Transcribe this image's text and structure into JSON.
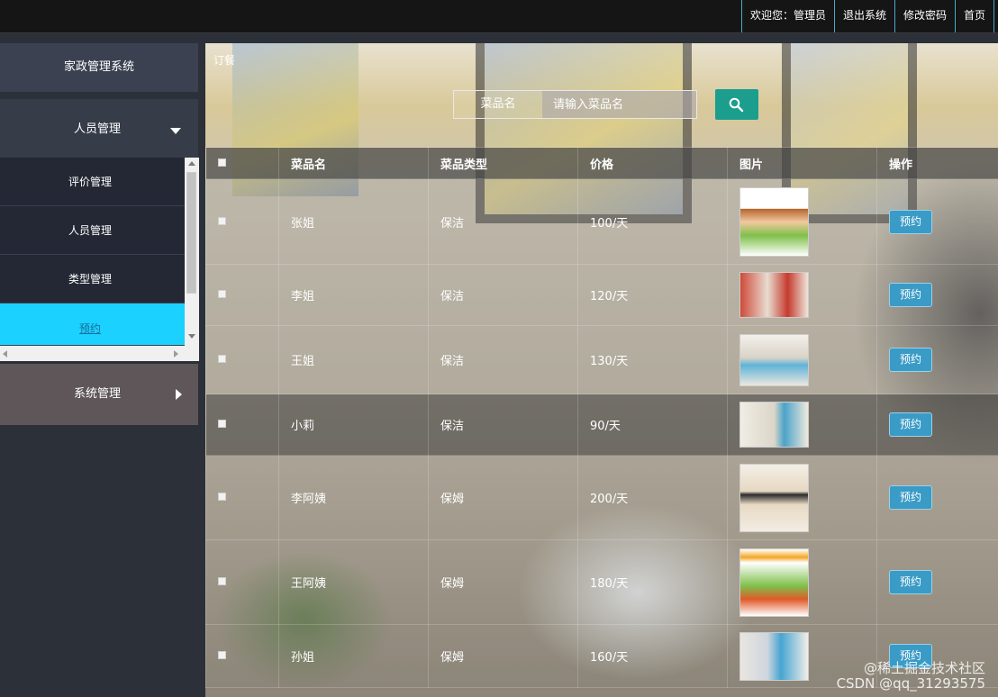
{
  "topnav": {
    "welcome": "欢迎您：管理员",
    "logout": "退出系统",
    "change_password": "修改密码",
    "home": "首页"
  },
  "sidebar": {
    "title": "家政管理系统",
    "groups": [
      {
        "label": "人员管理",
        "expanded": true
      },
      {
        "label": "系统管理",
        "expanded": false
      }
    ],
    "submenu": [
      {
        "label": "评价管理"
      },
      {
        "label": "人员管理"
      },
      {
        "label": "类型管理"
      },
      {
        "label": "预约",
        "active": true
      }
    ]
  },
  "main": {
    "breadcrumb": "订餐",
    "search": {
      "label": "菜品名",
      "placeholder": "请输入菜品名"
    },
    "table": {
      "headers": [
        "菜品名",
        "菜品类型",
        "价格",
        "图片",
        "操作"
      ],
      "rows": [
        {
          "name": "张姐",
          "type": "保洁",
          "price": "100/天",
          "action": "预约"
        },
        {
          "name": "李姐",
          "type": "保洁",
          "price": "120/天",
          "action": "预约"
        },
        {
          "name": "王姐",
          "type": "保洁",
          "price": "130/天",
          "action": "预约"
        },
        {
          "name": "小莉",
          "type": "保洁",
          "price": "90/天",
          "action": "预约"
        },
        {
          "name": "李阿姨",
          "type": "保姆",
          "price": "200/天",
          "action": "预约"
        },
        {
          "name": "王阿姨",
          "type": "保姆",
          "price": "180/天",
          "action": "预约"
        },
        {
          "name": "孙姐",
          "type": "保姆",
          "price": "160/天",
          "action": "预约"
        }
      ]
    }
  },
  "watermark": {
    "line1": "@稀土掘金技术社区",
    "line2": "CSDN @qq_31293575"
  },
  "colors": {
    "accent_cyan": "#1ad1ff",
    "search_button": "#1b9e8e",
    "book_button": "#3a9bc6"
  }
}
